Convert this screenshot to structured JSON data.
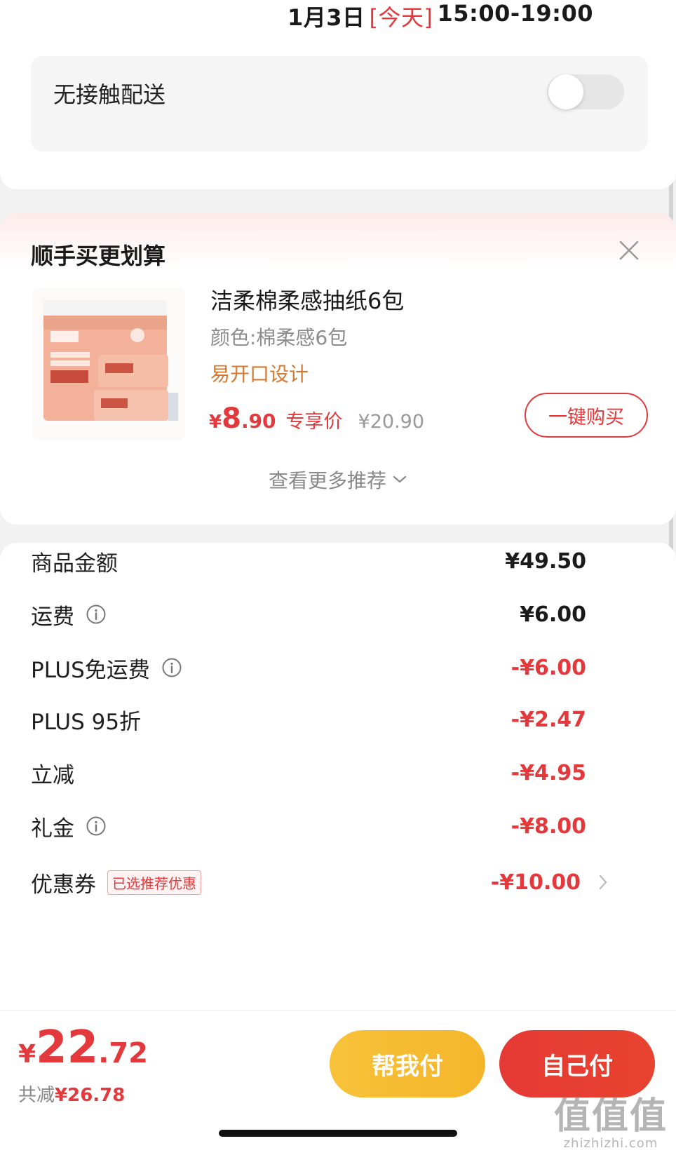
{
  "delivery": {
    "date": "1月3日",
    "today_tag": "[今天]",
    "time_range": "15:00-19:00"
  },
  "contactless": {
    "label": "无接触配送",
    "enabled": false
  },
  "recommendation": {
    "title": "顺手买更划算",
    "product": {
      "name": "洁柔棉柔感抽纸6包",
      "spec": "颜色:棉柔感6包",
      "feature": "易开口设计",
      "price_symbol": "¥",
      "price_int": "8",
      "price_dec": ".90",
      "price_tag": "专享价",
      "original_price": "¥20.90",
      "buy_label": "一键购买"
    },
    "more_label": "查看更多推荐"
  },
  "summary": {
    "rows": [
      {
        "label": "商品金额",
        "value": "¥49.50",
        "info": false,
        "negative": false
      },
      {
        "label": "运费",
        "value": "¥6.00",
        "info": true,
        "negative": false
      },
      {
        "label": "PLUS免运费",
        "value": "-¥6.00",
        "info": true,
        "negative": true
      },
      {
        "label": "PLUS 95折",
        "value": "-¥2.47",
        "info": false,
        "negative": true
      },
      {
        "label": "立减",
        "value": "-¥4.95",
        "info": false,
        "negative": true
      },
      {
        "label": "礼金",
        "value": "-¥8.00",
        "info": true,
        "negative": true
      }
    ],
    "coupon": {
      "label": "优惠券",
      "badge": "已选推荐优惠",
      "value": "-¥10.00"
    }
  },
  "footer": {
    "total_symbol": "¥",
    "total_int": "22",
    "total_dec": ".72",
    "saved_label": "共减",
    "saved_amount": "¥26.78",
    "help_pay_label": "帮我付",
    "self_pay_label": "自己付"
  },
  "watermark": {
    "logo": "值值值",
    "url": "zhizhizhi.com"
  },
  "colors": {
    "accent_red": "#e4393c",
    "accent_orange": "#d4792f",
    "help_yellow": "#f7c23a"
  }
}
